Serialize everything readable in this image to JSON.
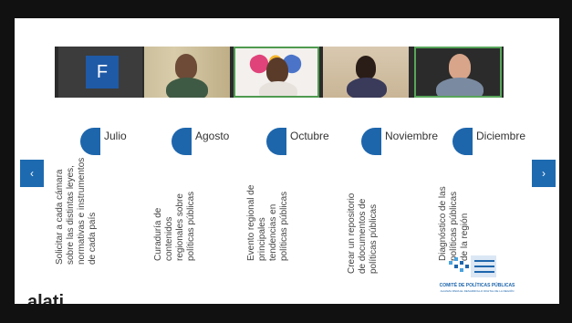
{
  "video": {
    "avatar_letter": "F"
  },
  "timeline": [
    {
      "month": "Julio",
      "desc": "Solicitar a cada cámara\nsobre las distintas leyes,\nnormativas e instrumentos\nde cada país"
    },
    {
      "month": "Agosto",
      "desc": "Curaduría de\ncontenidos\nregionales sobre\npolíticas públicas"
    },
    {
      "month": "Octubre",
      "desc": "Evento regional de\nprincipales\ntendencias en\npolíticas públicas"
    },
    {
      "month": "Noviembre",
      "desc": "Crear un repositorio\nde documentos de\npolíticas públicas"
    },
    {
      "month": "Diciembre",
      "desc": "Diagnóstico de las\npolíticas públicas\nde la región"
    }
  ],
  "nav": {
    "prev": "‹",
    "next": "›"
  },
  "logo": {
    "title": "COMITÉ DE POLÍTICAS PÚBLICAS",
    "subtitle": "ALIANZA PARA EL DESARROLLO DIGITAL DE LA REGIÓN"
  },
  "brand": "alati",
  "colors": {
    "accent": "#1e66ac"
  }
}
